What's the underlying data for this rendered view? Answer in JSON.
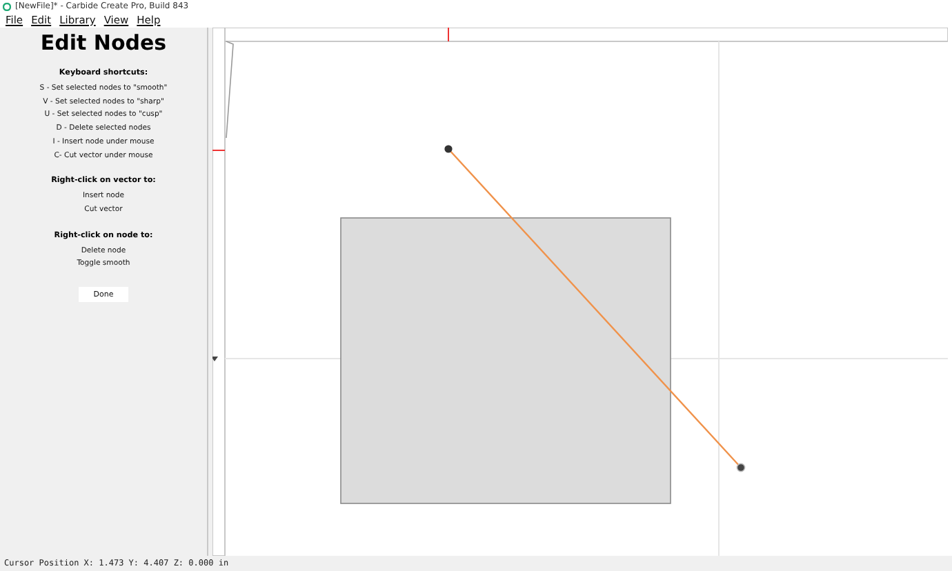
{
  "window": {
    "title": "[NewFile]* - Carbide Create Pro, Build 843"
  },
  "menu": [
    "File",
    "Edit",
    "Library",
    "View",
    "Help"
  ],
  "panel": {
    "title": "Edit Nodes",
    "sections": [
      {
        "heading": "Keyboard shortcuts:",
        "lines": [
          "S - Set selected nodes to \"smooth\"",
          "V - Set selected nodes to \"sharp\"",
          "U - Set selected nodes to \"cusp\"",
          "D - Delete selected nodes",
          "I - Insert node under mouse",
          "C- Cut vector under mouse"
        ]
      },
      {
        "heading": "Right-click on vector to:",
        "lines": [
          "Insert node",
          "Cut vector"
        ]
      },
      {
        "heading": "Right-click on node to:",
        "lines": [
          "Delete node",
          "Toggle smooth"
        ]
      }
    ],
    "button": "Done"
  },
  "status_bar": "Cursor Position X: 1.473 Y: 4.407 Z: 0.000 in"
}
